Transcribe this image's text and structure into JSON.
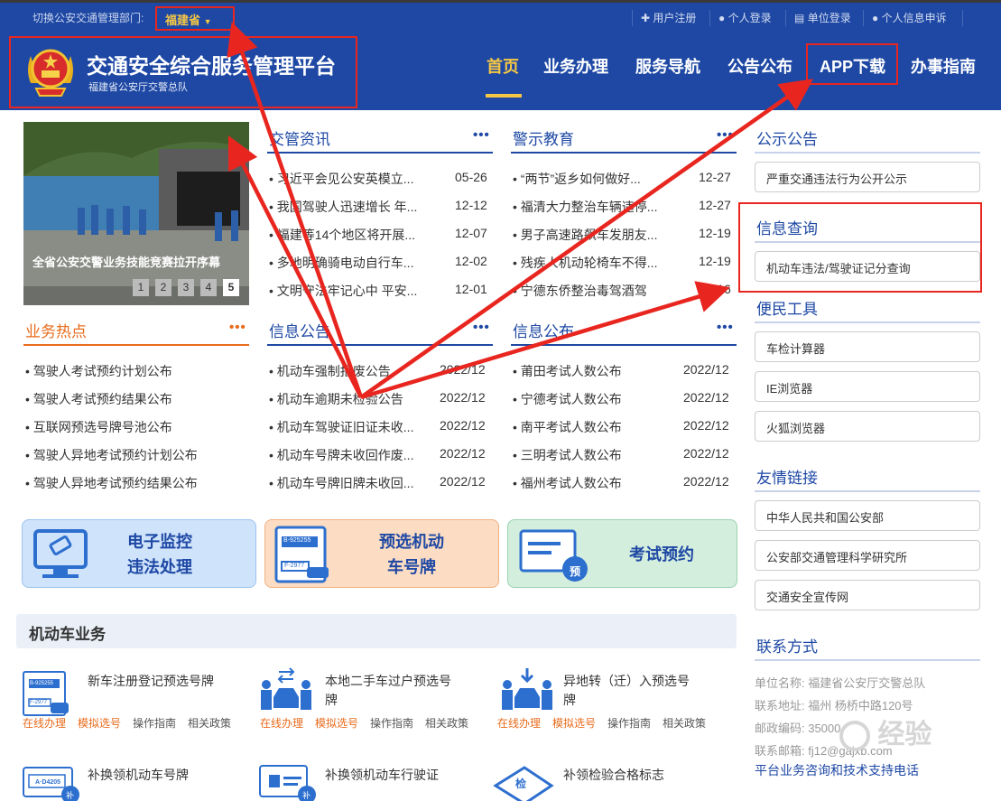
{
  "topbar": {
    "switch_label": "切换公安交通管理部门:",
    "province": "福建省",
    "links": [
      "用户注册",
      "个人登录",
      "单位登录",
      "个人信息申诉"
    ]
  },
  "header": {
    "title": "交通安全综合服务管理平台",
    "subtitle": "福建省公安厅交警总队",
    "nav": [
      "首页",
      "业务办理",
      "服务导航",
      "公告公布",
      "APP下载",
      "办事指南"
    ]
  },
  "carousel": {
    "caption": "全省公安交警业务技能竞赛拉开序幕",
    "pages": [
      "1",
      "2",
      "3",
      "4",
      "5"
    ],
    "active_page": 5
  },
  "news": {
    "title": "交管资讯",
    "items": [
      {
        "t": "习近平会见公安英模立...",
        "d": "05-26"
      },
      {
        "t": "我国驾驶人迅速增长 年...",
        "d": "12-12"
      },
      {
        "t": "福建等14个地区将开展...",
        "d": "12-07"
      },
      {
        "t": "多地明确骑电动自行车...",
        "d": "12-02"
      },
      {
        "t": "文明守法牢记心中 平安...",
        "d": "12-01"
      }
    ]
  },
  "warning": {
    "title": "警示教育",
    "items": [
      {
        "t": "“两节”返乡如何做好...",
        "d": "12-27"
      },
      {
        "t": "福清大力整治车辆违停...",
        "d": "12-27"
      },
      {
        "t": "男子高速路飙车发朋友...",
        "d": "12-19"
      },
      {
        "t": "残疾人机动轮椅车不得...",
        "d": "12-19"
      },
      {
        "t": "宁德东侨整治毒驾酒驾",
        "d": "12-16"
      }
    ]
  },
  "hot": {
    "title": "业务热点",
    "items": [
      "驾驶人考试预约计划公布",
      "驾驶人考试预约结果公布",
      "互联网预选号牌号池公布",
      "驾驶人异地考试预约计划公布",
      "驾驶人异地考试预约结果公布"
    ]
  },
  "info": {
    "title": "信息公告",
    "items": [
      {
        "t": "机动车强制报废公告",
        "d": "2022/12"
      },
      {
        "t": "机动车逾期未检验公告",
        "d": "2022/12"
      },
      {
        "t": "机动车驾驶证旧证未收...",
        "d": "2022/12"
      },
      {
        "t": "机动车号牌未收回作废...",
        "d": "2022/12"
      },
      {
        "t": "机动车号牌旧牌未收回...",
        "d": "2022/12"
      }
    ]
  },
  "publish": {
    "title": "信息公布",
    "items": [
      {
        "t": "莆田考试人数公布",
        "d": "2022/12"
      },
      {
        "t": "宁德考试人数公布",
        "d": "2022/12"
      },
      {
        "t": "南平考试人数公布",
        "d": "2022/12"
      },
      {
        "t": "三明考试人数公布",
        "d": "2022/12"
      },
      {
        "t": "福州考试人数公布",
        "d": "2022/12"
      }
    ]
  },
  "more": "•••",
  "sidebar": {
    "notice_title": "公示公告",
    "notice_item": "严重交通违法行为公开公示",
    "query_title": "信息查询",
    "query_item": "机动车违法/驾驶证记分查询",
    "tools_title": "便民工具",
    "tools": [
      "车检计算器",
      "IE浏览器",
      "火狐浏览器"
    ],
    "links_title": "友情链接",
    "links": [
      "中华人民共和国公安部",
      "公安部交通管理科学研究所",
      "交通安全宣传网"
    ],
    "contact_title": "联系方式",
    "contact": [
      "单位名称: 福建省公安厅交警总队",
      "联系地址: 福州 杨桥中路120号",
      "邮政编码: 35000",
      "联系邮箱: fj12@gajxb.com",
      "平台业务咨询和技术支持电话"
    ]
  },
  "tiles": [
    {
      "title": "电子监控\n违法处理",
      "color": "#cfe3fb",
      "text_color": "#1e48a4"
    },
    {
      "title": "预选机动\n车号牌",
      "color": "#fcdcc2",
      "text_color": "#1e48a4",
      "plates": [
        "B-925255",
        "F-2977"
      ]
    },
    {
      "title": "考试预约",
      "color": "#d3eedd",
      "text_color": "#1e48a4",
      "badge": "预"
    }
  ],
  "vehicle": {
    "title": "机动车业务",
    "services": [
      {
        "title": "新车注册登记预选号牌",
        "links": [
          "在线办理",
          "模拟选号",
          "操作指南",
          "相关政策"
        ],
        "plates": [
          "B-925255",
          "F-2977"
        ]
      },
      {
        "title": "本地二手车过户预选号牌",
        "links": [
          "在线办理",
          "模拟选号",
          "操作指南",
          "相关政策"
        ]
      },
      {
        "title": "异地转（迁）入预选号牌",
        "links": [
          "在线办理",
          "模拟选号",
          "操作指南",
          "相关政策"
        ]
      },
      {
        "title": "补换领机动车号牌",
        "plate": "A·D4205",
        "badge": "补"
      },
      {
        "title": "补换领机动车行驶证",
        "badge": "补"
      },
      {
        "title": "补领检验合格标志",
        "badge": "检"
      }
    ]
  },
  "watermark": "经验"
}
